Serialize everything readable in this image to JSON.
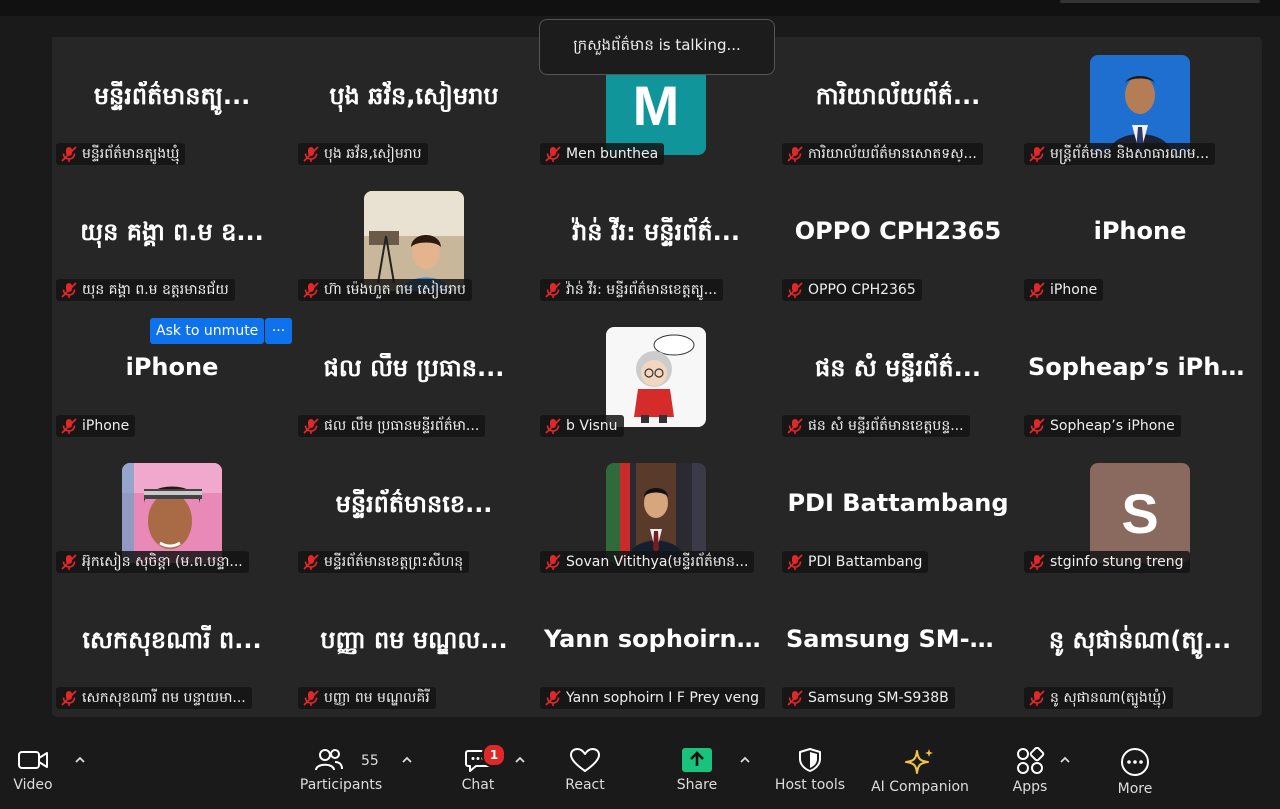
{
  "talking": "ក្រសួងព័ត៌មាន is talking...",
  "ask_unmute": {
    "label": "Ask to unmute",
    "more": "···"
  },
  "colors": {
    "accent": "#0e72ed",
    "muted_mic": "#e02828",
    "share_green": "#19c37d"
  },
  "tiles": [
    {
      "name": "មន្ទីរព័ត៌មានត្បូ...",
      "label": "មន្ទីរព័ត៌មានត្បូងឃ្មុំ"
    },
    {
      "name": "បុង ឆវ័ន,សៀមរាប",
      "label": "បុង ឆវ័ន,សៀមរាប"
    },
    {
      "avatar": "M",
      "label": "Men bunthea"
    },
    {
      "name": "ការិយាល័យព័ត៌...",
      "label": "ការិយាល័យព័ត៌មានសោតទស្..."
    },
    {
      "photo": "portrait-man-blue-background",
      "label": "មន្ត្រីព័ត៌មាន និងសាធារណម..."
    },
    {
      "name": "យុន គង្គា ព.ម ឧ...",
      "label": "យុន គង្គា ព.ម ឧត្តរមានជ័យ"
    },
    {
      "photo": "boy-indoor-photo",
      "label": "ហ៊ា ម៉េងហួត ពម សៀមរាប"
    },
    {
      "name": "វ៉ាន់ វីរ: មន្ទីរព័ត៌...",
      "label": "វ៉ាន់ វីរ: មន្ទីរព័ត៌មានខេត្តត្បូ..."
    },
    {
      "name": "OPPO CPH2365",
      "label": "OPPO CPH2365"
    },
    {
      "name": "iPhone",
      "label": "iPhone"
    },
    {
      "name": "iPhone",
      "label": "iPhone"
    },
    {
      "name": "ផល លឹម ប្រធាន...",
      "label": "ផល លឹម ប្រធានមន្ទីរព័ត៌មា..."
    },
    {
      "photo": "cartoon-grandpa",
      "label": "b Visnu"
    },
    {
      "name": "ផន សំ មន្ទីរព័ត៌...",
      "label": "ផន សំ មន្ទីរព័ត៌មានខេត្តបន្ទ..."
    },
    {
      "name": "Sopheap’s iPhone",
      "label": "Sopheap’s iPhone"
    },
    {
      "photo": "woman-headband",
      "label": "អ៊ុកសៀន សុចិន្តា (ម.ព.បន្ទា..."
    },
    {
      "name": "មន្ទីរព័ត៌មានខេ...",
      "label": "មន្ទីរព័ត៌មានខេត្តព្រះសីហនុ"
    },
    {
      "photo": "man-in-suit-office",
      "label": "Sovan Vitithya(មន្ទីរព័ត៌មាន..."
    },
    {
      "name": "PDI Battambang",
      "label": "PDI Battambang"
    },
    {
      "avatar": "S",
      "label": "stginfo stung treng"
    },
    {
      "name": "សេកសុខណារី ព...",
      "label": "សេកសុខណារី ពម បន្ទាយមា..."
    },
    {
      "name": "បញ្ញា ពម មណ្ឌល...",
      "label": "បញ្ញា ពម មណ្ឌលគិរី"
    },
    {
      "name": "Yann sophoirn I...",
      "label": "Yann sophoirn I F Prey veng"
    },
    {
      "name": "Samsung SM-S...",
      "label": "Samsung SM-S938B"
    },
    {
      "name": "នូ សុផាន់ណា(ត្បូ...",
      "label": "នូ សុផានណា(ត្បូងឃ្មុំ)"
    }
  ],
  "toolbar": {
    "video": "Video",
    "participants": "Participants",
    "participants_count": "55",
    "chat": "Chat",
    "chat_badge": "1",
    "react": "React",
    "share": "Share",
    "host_tools": "Host tools",
    "ai_companion": "AI Companion",
    "apps": "Apps",
    "more": "More"
  }
}
